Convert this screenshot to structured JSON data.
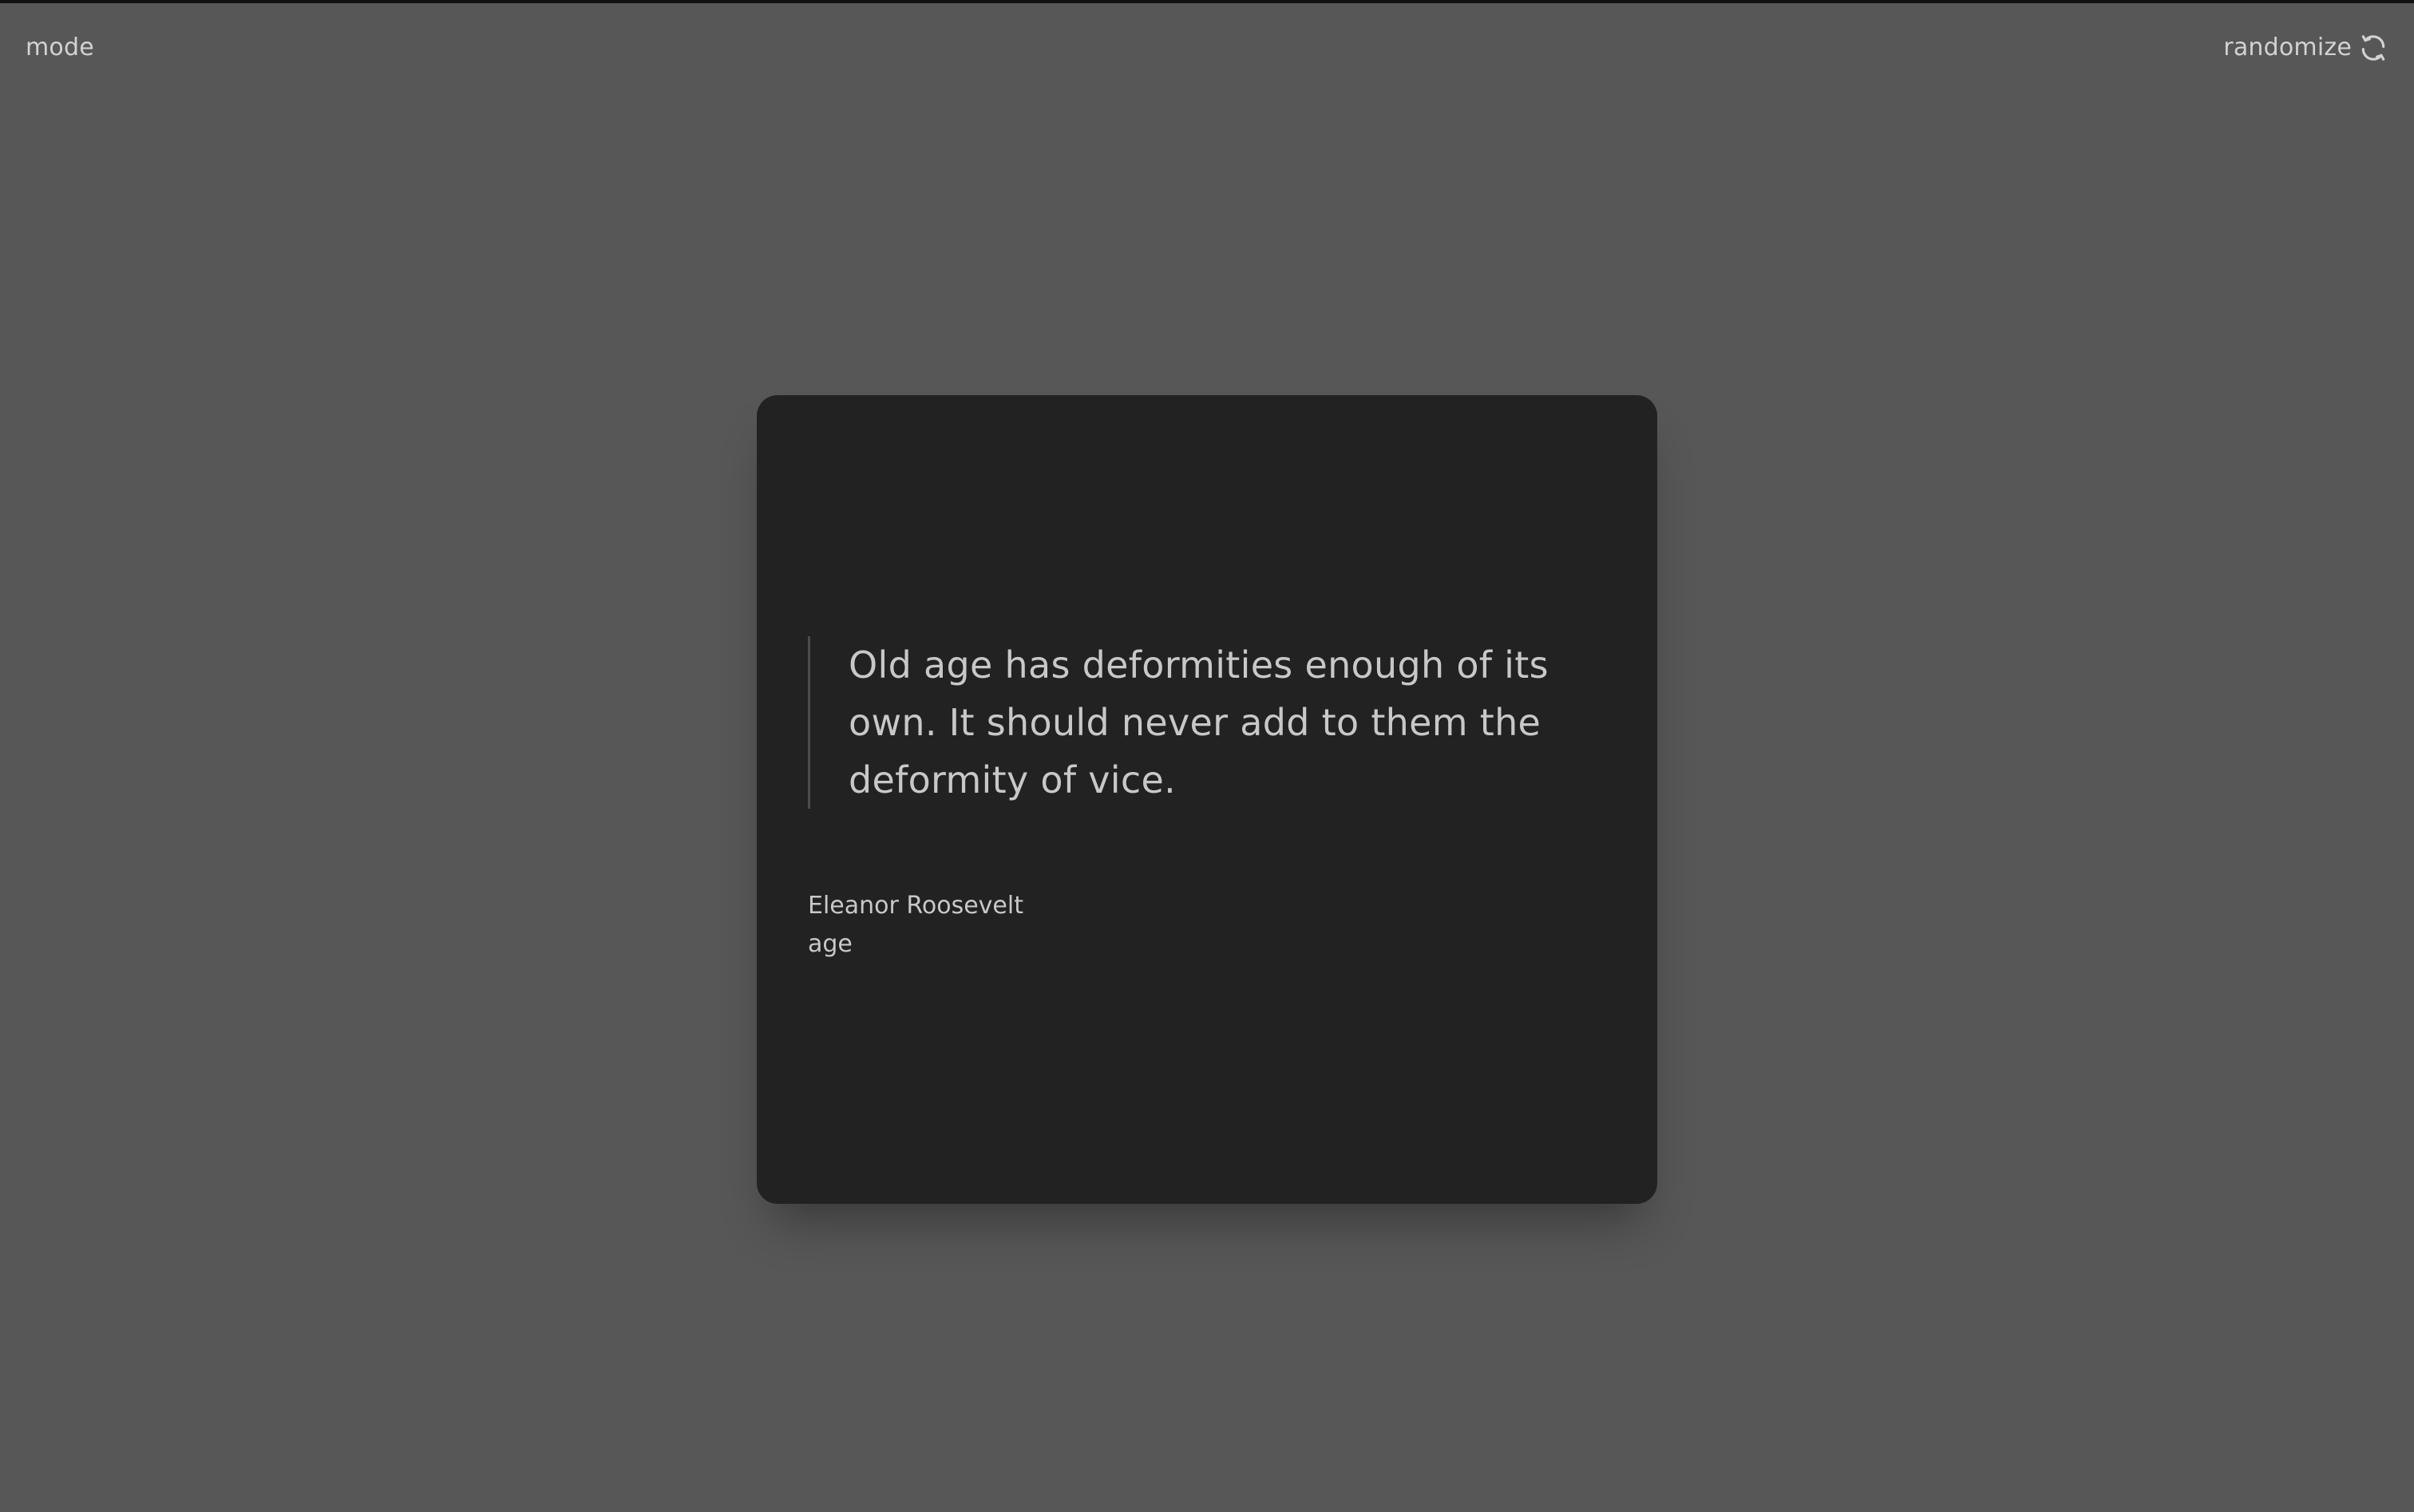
{
  "header": {
    "mode_label": "mode",
    "randomize_label": "randomize",
    "randomize_icon": "refresh-icon"
  },
  "quote": {
    "text": "Old age has deformities enough of its own. It should never add to them the deformity of vice.",
    "author": "Eleanor Roosevelt",
    "tag": "age"
  },
  "colors": {
    "background": "#575757",
    "card": "#222222",
    "text": "#c8c8c8",
    "accent_border": "#4d4d4d"
  }
}
